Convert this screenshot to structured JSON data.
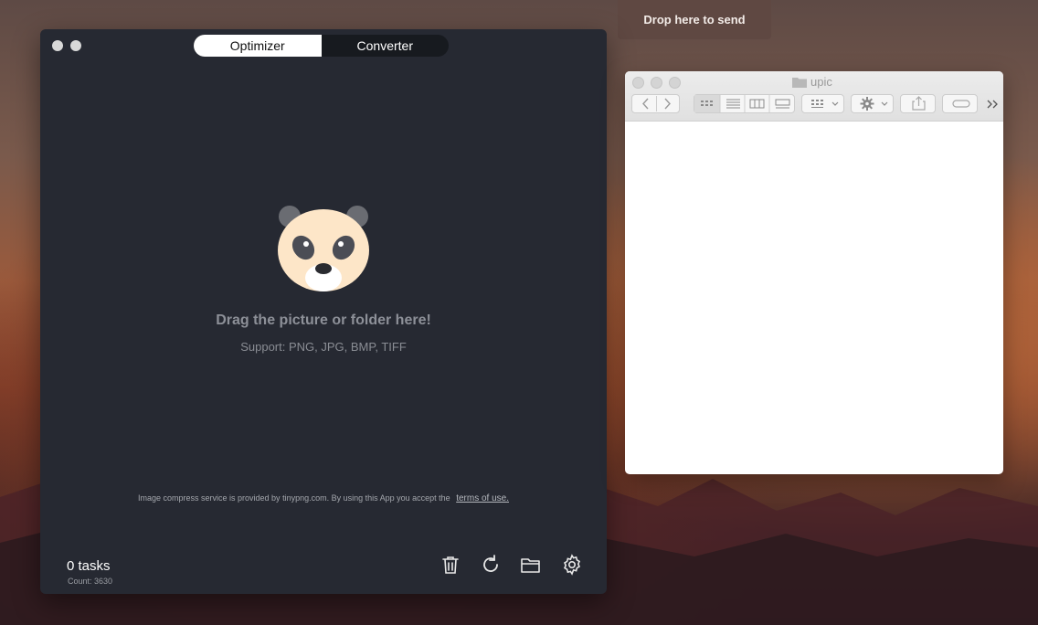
{
  "drop_target": {
    "label": "Drop here to send"
  },
  "optimizer": {
    "tabs": [
      {
        "label": "Optimizer",
        "active": true
      },
      {
        "label": "Converter",
        "active": false
      }
    ],
    "drop_title": "Drag the picture or folder here!",
    "support_text": "Support: PNG, JPG, BMP, TIFF",
    "legal_text": "Image compress service is provided by tinypng.com. By using this App you accept the",
    "legal_link": "terms of use.",
    "tasks_label": "0 tasks",
    "count_label": "Count: 3630",
    "toolbar_icons": [
      "trash-icon",
      "refresh-icon",
      "folder-icon",
      "gear-icon"
    ]
  },
  "finder": {
    "title": "upic",
    "icons": [
      "back-icon",
      "forward-icon",
      "icon-view-icon",
      "list-view-icon",
      "column-view-icon",
      "gallery-view-icon",
      "group-icon",
      "action-gear-icon",
      "share-icon",
      "tag-icon",
      "overflow-icon"
    ]
  },
  "colors": {
    "app_bg": "#262932",
    "accent_white": "#ffffff",
    "panda_face": "#fde6c8"
  }
}
